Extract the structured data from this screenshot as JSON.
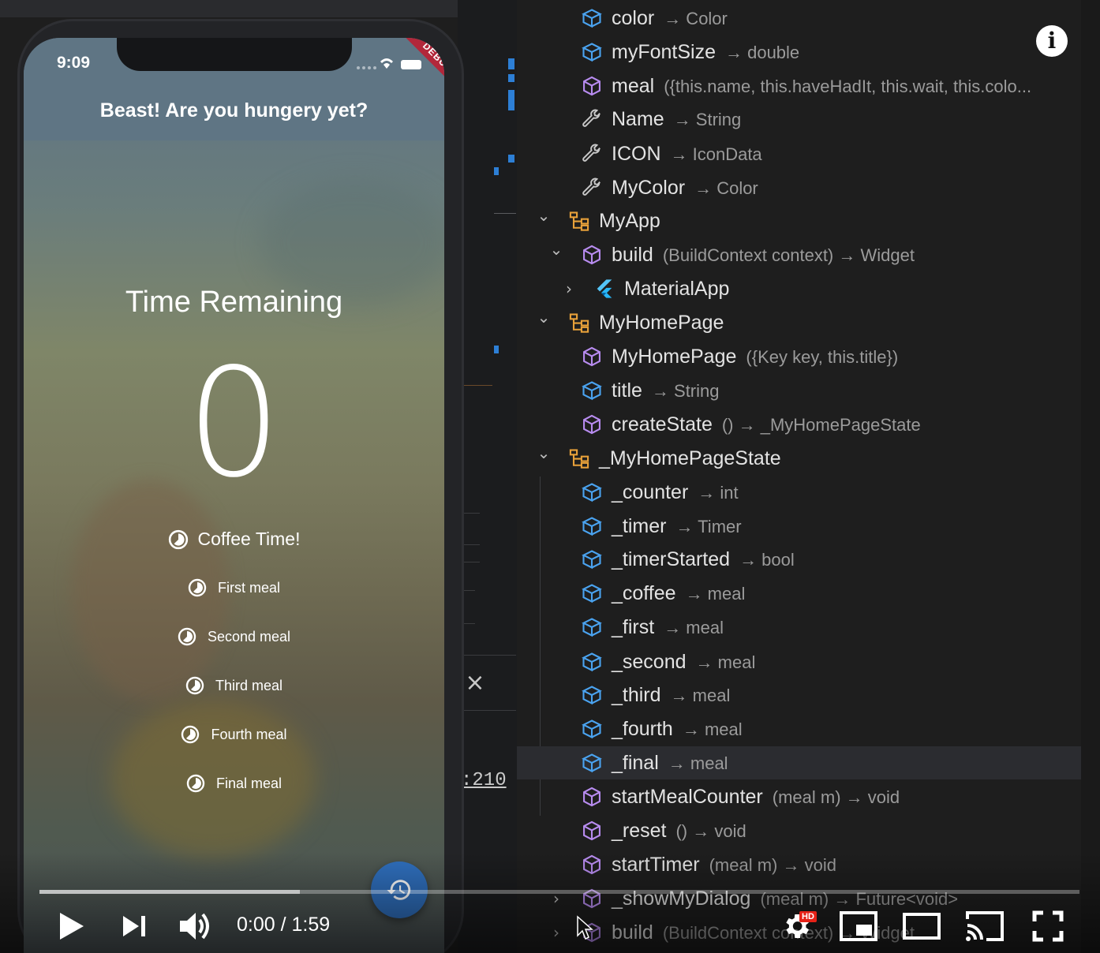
{
  "phone": {
    "status_time": "9:09",
    "debug_banner": "DEBUG",
    "app_bar_title": "Beast! Are you hungery yet?",
    "time_remaining_label": "Time Remaining",
    "counter_value": "0",
    "meal_buttons": [
      {
        "label": "Coffee Time!"
      },
      {
        "label": "First meal"
      },
      {
        "label": "Second meal"
      },
      {
        "label": "Third meal"
      },
      {
        "label": "Fourth meal"
      },
      {
        "label": "Final meal"
      }
    ]
  },
  "editor": {
    "line_reference": ":210"
  },
  "outline": {
    "rows": [
      {
        "name": "color",
        "detail": "→ Color",
        "kind": "field"
      },
      {
        "name": "myFontSize",
        "detail": "→ double",
        "kind": "field"
      },
      {
        "name": "meal",
        "detail": "({this.name, this.haveHadIt, this.wait, this.colo...",
        "kind": "method"
      },
      {
        "name": "Name",
        "detail": "→ String",
        "kind": "property"
      },
      {
        "name": "ICON",
        "detail": "→ IconData",
        "kind": "property"
      },
      {
        "name": "MyColor",
        "detail": "→ Color",
        "kind": "property"
      },
      {
        "name": "MyApp",
        "detail": "",
        "kind": "class"
      },
      {
        "name": "build",
        "detail": "(BuildContext context) → Widget",
        "kind": "method"
      },
      {
        "name": "MaterialApp",
        "detail": "",
        "kind": "flutter"
      },
      {
        "name": "MyHomePage",
        "detail": "",
        "kind": "class"
      },
      {
        "name": "MyHomePage",
        "detail": "({Key key, this.title})",
        "kind": "method"
      },
      {
        "name": "title",
        "detail": "→ String",
        "kind": "field"
      },
      {
        "name": "createState",
        "detail": "() → _MyHomePageState",
        "kind": "method"
      },
      {
        "name": "_MyHomePageState",
        "detail": "",
        "kind": "class"
      },
      {
        "name": "_counter",
        "detail": "→ int",
        "kind": "field"
      },
      {
        "name": "_timer",
        "detail": "→ Timer",
        "kind": "field"
      },
      {
        "name": "_timerStarted",
        "detail": "→ bool",
        "kind": "field"
      },
      {
        "name": "_coffee",
        "detail": "→ meal",
        "kind": "field"
      },
      {
        "name": "_first",
        "detail": "→ meal",
        "kind": "field"
      },
      {
        "name": "_second",
        "detail": "→ meal",
        "kind": "field"
      },
      {
        "name": "_third",
        "detail": "→ meal",
        "kind": "field"
      },
      {
        "name": "_fourth",
        "detail": "→ meal",
        "kind": "field"
      },
      {
        "name": "_final",
        "detail": "→ meal",
        "kind": "field"
      },
      {
        "name": "startMealCounter",
        "detail": "(meal m) → void",
        "kind": "method"
      },
      {
        "name": "_reset",
        "detail": "() → void",
        "kind": "method"
      },
      {
        "name": "startTimer",
        "detail": "(meal m) → void",
        "kind": "method"
      },
      {
        "name": "_showMyDialog",
        "detail": "(meal m) → Future<void>",
        "kind": "method"
      },
      {
        "name": "build",
        "detail": "(BuildContext context) → Widget",
        "kind": "method"
      }
    ]
  },
  "player": {
    "time_display": "0:00 / 1:59",
    "hd_badge": "HD",
    "info_label": "i",
    "buffered_fraction": 0.25
  },
  "colors": {
    "field_icon": "#4aa3f0",
    "method_icon": "#b88cf0",
    "class_icon": "#e8a13a",
    "fab": "#2f6fbd",
    "debug_banner": "#b2273a"
  }
}
